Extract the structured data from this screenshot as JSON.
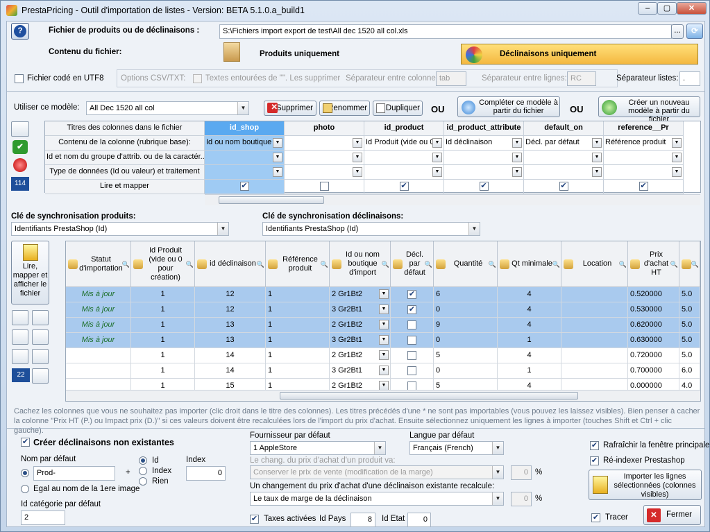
{
  "window": {
    "title": "PrestaPricing - Outil d'importation de listes  -  Version:  BETA 5.1.0.a_build1"
  },
  "file": {
    "label": "Fichier de produits ou de déclinaisons :",
    "path": "S:\\Fichiers import export de test\\All dec 1520 all col.xls",
    "browse": "...",
    "content_label": "Contenu du fichier:",
    "products_only": "Produits uniquement",
    "declinations_only": "Déclinaisons uniquement"
  },
  "csv": {
    "utf8": "Fichier codé en UTF8",
    "options": "Options CSV/TXT:",
    "quoted": "Textes entourées de \"\". Les supprimer",
    "col_sep_label": "Séparateur entre colonnes:",
    "col_sep": "tab",
    "line_sep_label": "Séparateur entre lignes:",
    "line_sep": "RC",
    "list_sep_label": "Séparateur listes:",
    "list_sep": "."
  },
  "model": {
    "label": "Utiliser ce modèle:",
    "value": "All Dec 1520 all col",
    "delete": "Supprimer",
    "rename": "Renommer",
    "duplicate": "Dupliquer",
    "or1": "OU",
    "complete": "Compléter ce modèle à partir du fichier",
    "or2": "OU",
    "create": "Créer un nouveau modèle à partir du fichier"
  },
  "mapping": {
    "row_labels": [
      "Titres des colonnes dans le fichier",
      "Contenu de la colonne (rubrique base):",
      "Id et nom du groupe d'attrib. ou de la caractér...",
      "Type de données (Id ou valeur) et traitement",
      "Lire et mapper"
    ],
    "columns": [
      {
        "title": "id_shop",
        "content": "Id ou nom boutique",
        "mapped": true
      },
      {
        "title": "photo",
        "content": "",
        "mapped": false
      },
      {
        "title": "id_product",
        "content": "Id Produit  (vide ou 0",
        "mapped": true
      },
      {
        "title": "id_product_attribute",
        "content": "Id déclinaison",
        "mapped": true
      },
      {
        "title": "default_on",
        "content": "Décl. par défaut",
        "mapped": true
      },
      {
        "title": "reference__Pr",
        "content": "Référence produit",
        "mapped": true
      }
    ],
    "side_badge": "114"
  },
  "sync": {
    "products_label": "Clé de synchronisation produits:",
    "products_value": "Identifiants PrestaShop (Id)",
    "decl_label": "Clé de synchronisation déclinaisons:",
    "decl_value": "Identifiants PrestaShop (Id)"
  },
  "read_btn": "Lire, mapper et afficher le fichier",
  "side_badge2": "22",
  "table": {
    "headers": [
      "Statut d'importation",
      "Id Produit (vide ou 0 pour création)",
      "id déclinaison",
      "Référence produit",
      "Id ou nom boutique d'import",
      "Décl. par défaut",
      "Quantité",
      "Qt minimale",
      "Location",
      "Prix d'achat HT",
      ""
    ],
    "rows": [
      {
        "status": "Mis à jour",
        "idp": "1",
        "idd": "12",
        "ref": "1",
        "shop": "2 Gr1Bt2",
        "def": true,
        "qty": "6",
        "qmin": "4",
        "loc": "",
        "price": "0.520000",
        "x": "5.0",
        "sel": true
      },
      {
        "status": "Mis à jour",
        "idp": "1",
        "idd": "12",
        "ref": "1",
        "shop": "3 Gr2Bt1",
        "def": true,
        "qty": "0",
        "qmin": "4",
        "loc": "",
        "price": "0.530000",
        "x": "5.0",
        "sel": true
      },
      {
        "status": "Mis à jour",
        "idp": "1",
        "idd": "13",
        "ref": "1",
        "shop": "2 Gr1Bt2",
        "def": false,
        "qty": "9",
        "qmin": "4",
        "loc": "",
        "price": "0.620000",
        "x": "5.0",
        "sel": true
      },
      {
        "status": "Mis à jour",
        "idp": "1",
        "idd": "13",
        "ref": "1",
        "shop": "3 Gr2Bt1",
        "def": false,
        "qty": "0",
        "qmin": "1",
        "loc": "",
        "price": "0.630000",
        "x": "5.0",
        "sel": true
      },
      {
        "status": "",
        "idp": "1",
        "idd": "14",
        "ref": "1",
        "shop": "2 Gr1Bt2",
        "def": false,
        "qty": "5",
        "qmin": "4",
        "loc": "",
        "price": "0.720000",
        "x": "5.0",
        "sel": false
      },
      {
        "status": "",
        "idp": "1",
        "idd": "14",
        "ref": "1",
        "shop": "3 Gr2Bt1",
        "def": false,
        "qty": "0",
        "qmin": "1",
        "loc": "",
        "price": "0.700000",
        "x": "6.0",
        "sel": false
      },
      {
        "status": "",
        "idp": "1",
        "idd": "15",
        "ref": "1",
        "shop": "2 Gr1Bt2",
        "def": false,
        "qty": "5",
        "qmin": "4",
        "loc": "",
        "price": "0.000000",
        "x": "4.0",
        "sel": false
      }
    ]
  },
  "hint": "Cachez les colonnes que vous ne souhaitez pas importer (clic droit dans le titre des colonnes). Les titres précédés d'une * ne sont pas importables (vous pouvez les laissez  visibles).  Bien penser à cacher la colonne \"Prix HT  (P.) ou Impact prix (D.)\" si ces valeurs doivent être recalculées lors de l'import du prix d'achat. Ensuite sélectionnez uniquement les lignes à importer (touches Shift et Ctrl + clic gauche).",
  "bottom": {
    "create_decl": "Créer déclinaisons non existantes",
    "name_label": "Nom par défaut",
    "name_value": "Prod-",
    "plus": "+",
    "opt_id": "Id",
    "opt_index": "Index",
    "opt_none": "Rien",
    "index_label": "Index",
    "index_value": "0",
    "same_name": "Egal au nom de la 1ere image",
    "cat_label": "Id catégorie par défaut",
    "cat_value": "2",
    "supplier_label": "Fournisseur par défaut",
    "supplier_value": "1 AppleStore",
    "lang_label": "Langue  par défaut",
    "lang_value": "Français (French)",
    "price_change_label": "Le chang. du prix d'achat d'un produit va:",
    "price_change_value": "Conserver le prix de vente (modification de la marge)",
    "pct1": "0",
    "pct_sym1": "%",
    "decl_change_label": "Un changement du prix d'achat d'une déclinaison existante recalcule:",
    "decl_change_value": "Le taux de marge de la déclinaison",
    "pct2": "0",
    "pct_sym2": "%",
    "tax_label": "Taxes activées",
    "idpays_label": "Id Pays",
    "idpays": "8",
    "idetat_label": "Id Etat",
    "idetat": "0",
    "refresh": "Rafraîchir la fenêtre principale",
    "reindex": "Ré-indexer Prestashop",
    "import_btn": "Importer les lignes sélectionnées (colonnes visibles)",
    "trace": "Tracer",
    "close": "Fermer"
  }
}
